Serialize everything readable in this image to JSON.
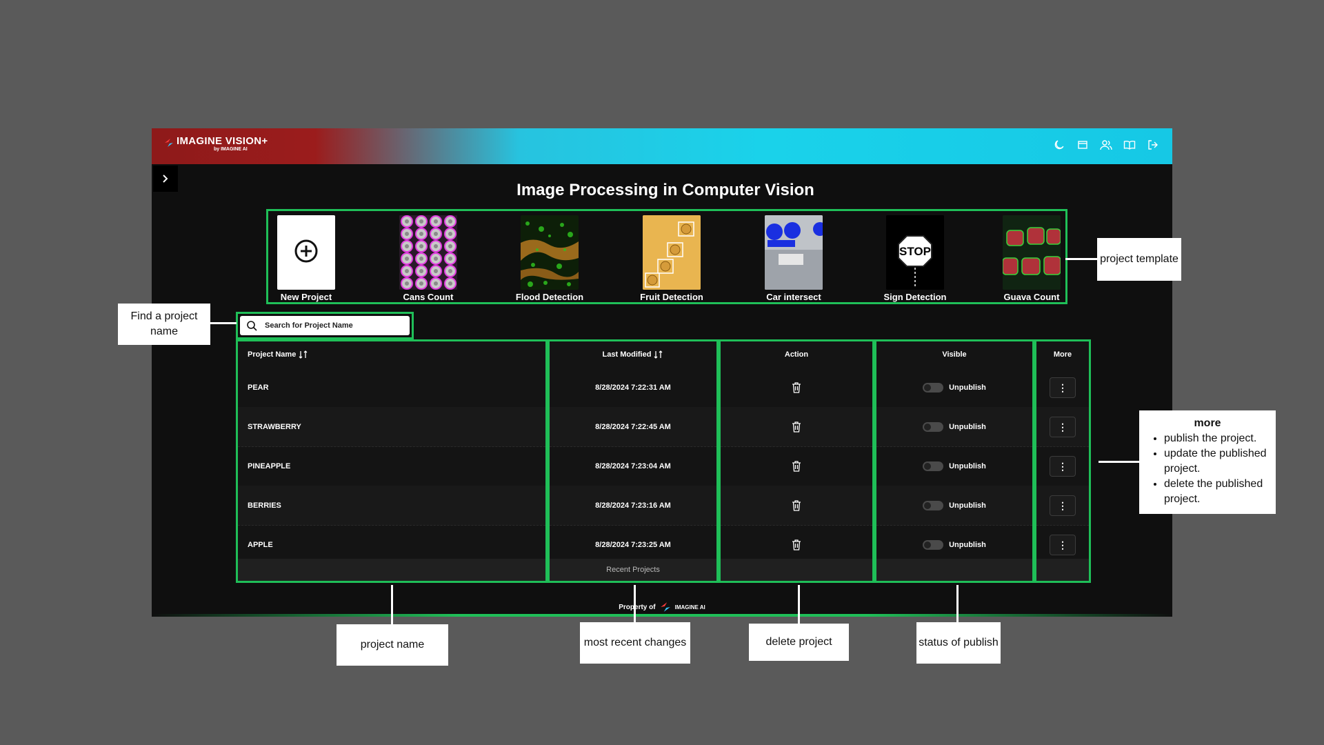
{
  "app": {
    "logo_text": "IMAGINE VISION+",
    "logo_sub": "by IMAGINE AI",
    "page_title": "Image Processing in Computer Vision",
    "top_icons": [
      "moon-icon",
      "window-icon",
      "users-icon",
      "book-icon",
      "logout-icon"
    ],
    "colors": {
      "accent_green": "#1fbf58",
      "brand_red": "#9b1c1c",
      "brand_cyan": "#1ad2ea"
    }
  },
  "templates": [
    {
      "name": "New Project"
    },
    {
      "name": "Cans Count"
    },
    {
      "name": "Flood Detection"
    },
    {
      "name": "Fruit Detection"
    },
    {
      "name": "Car intersect"
    },
    {
      "name": "Sign Detection"
    },
    {
      "name": "Guava Count"
    }
  ],
  "sign_text": "STOP",
  "search": {
    "placeholder": "Search for Project Name"
  },
  "table": {
    "headers": {
      "name": "Project Name",
      "modified": "Last Modified",
      "action": "Action",
      "visible": "Visible",
      "more": "More"
    },
    "rows": [
      {
        "name": "PEAR",
        "modified": "8/28/2024 7:22:31 AM",
        "status": "Unpublish"
      },
      {
        "name": "STRAWBERRY",
        "modified": "8/28/2024 7:22:45 AM",
        "status": "Unpublish"
      },
      {
        "name": "PINEAPPLE",
        "modified": "8/28/2024 7:23:04 AM",
        "status": "Unpublish"
      },
      {
        "name": "BERRIES",
        "modified": "8/28/2024 7:23:16 AM",
        "status": "Unpublish"
      },
      {
        "name": "APPLE",
        "modified": "8/28/2024 7:23:25 AM",
        "status": "Unpublish"
      }
    ],
    "footer": "Recent Projects"
  },
  "footer": {
    "text": "Property of",
    "logo_text": "IMAGINE AI"
  },
  "annotations": {
    "find": "Find a project name",
    "template": "project template",
    "name": "project name",
    "recent": "most recent changes",
    "delete": "delete project",
    "publish": "status of publish",
    "more_title": "more",
    "more_items": [
      "publish the project.",
      "update the published project.",
      "delete the published project."
    ]
  }
}
